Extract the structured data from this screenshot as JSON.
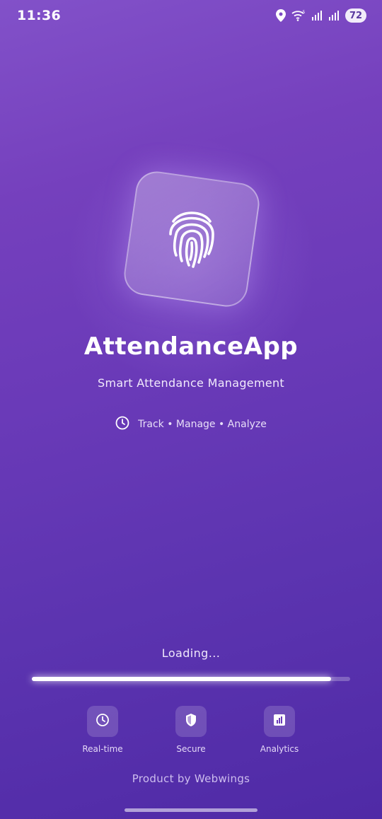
{
  "status_bar": {
    "time": "11:36",
    "battery": "72",
    "icons": [
      "location-icon",
      "wifi-icon",
      "signal-icon",
      "signal-icon"
    ]
  },
  "app": {
    "name": "AttendanceApp",
    "subtitle": "Smart Attendance Management",
    "tagline": "Track • Manage • Analyze",
    "logo_icon": "fingerprint-icon"
  },
  "loading": {
    "label": "Loading...",
    "progress": 0.94
  },
  "features": [
    {
      "label": "Real-time",
      "icon": "clock-icon"
    },
    {
      "label": "Secure",
      "icon": "shield-icon"
    },
    {
      "label": "Analytics",
      "icon": "bar-chart-icon"
    }
  ],
  "footer": "Product by Webwings",
  "colors": {
    "background_top": "#8251c9",
    "background_bottom": "#4f2aa6",
    "accent": "#ffffff"
  }
}
